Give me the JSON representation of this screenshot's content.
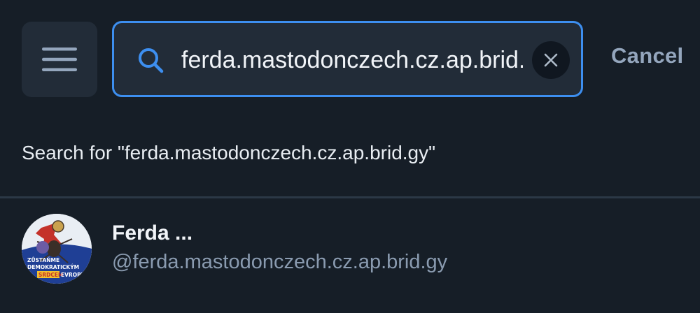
{
  "header": {
    "menu_icon": "hamburger-menu-icon",
    "search": {
      "value": "ferda.mastodonczech.cz.ap.brid.gy",
      "placeholder": "",
      "search_icon": "search-icon",
      "clear_icon": "close-icon"
    },
    "cancel_label": "Cancel"
  },
  "search_for_text": "Search for \"ferda.mastodonczech.cz.ap.brid.gy\"",
  "results": [
    {
      "name": "Ferda ...",
      "handle": "@ferda.mastodonczech.cz.ap.brid.gy",
      "avatar_text_lines": [
        "ZŮSTAŇME",
        "DEMOKRATICKÝM",
        "SRDCEM",
        "EVROPY"
      ]
    }
  ],
  "colors": {
    "background": "#161e27",
    "surface": "#222c38",
    "accent": "#3d8ff0",
    "muted_text": "#8a9bb0",
    "cancel_text": "#94a6bd"
  }
}
